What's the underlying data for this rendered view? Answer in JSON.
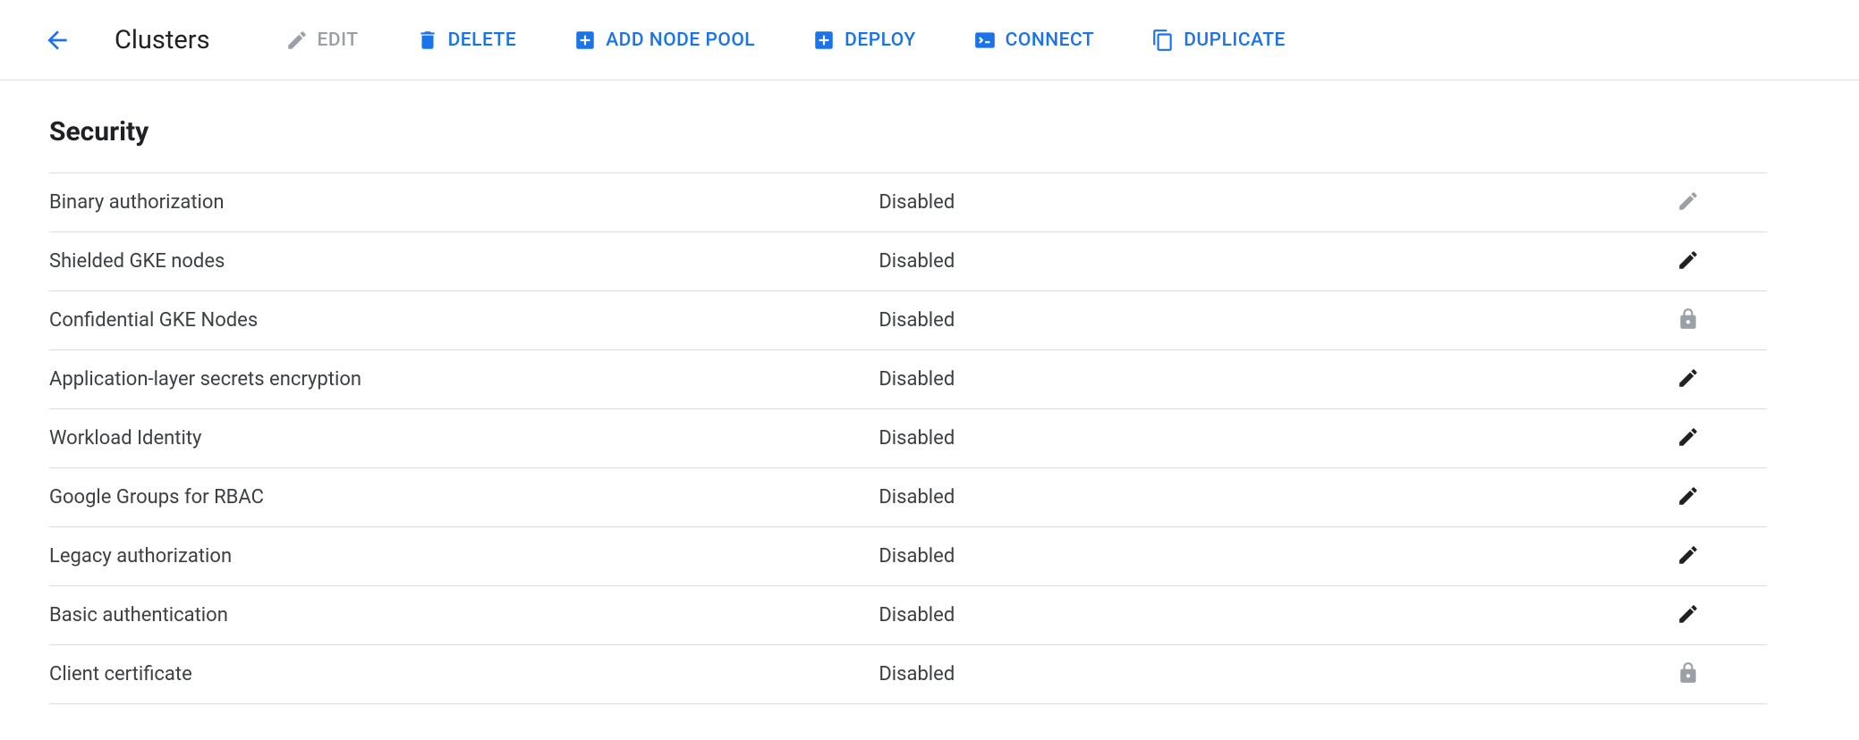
{
  "header": {
    "title": "Clusters",
    "actions": {
      "edit": "EDIT",
      "delete": "DELETE",
      "add_node_pool": "ADD NODE POOL",
      "deploy": "DEPLOY",
      "connect": "CONNECT",
      "duplicate": "DUPLICATE"
    }
  },
  "section": {
    "title": "Security",
    "rows": [
      {
        "label": "Binary authorization",
        "value": "Disabled",
        "action": "edit-dim"
      },
      {
        "label": "Shielded GKE nodes",
        "value": "Disabled",
        "action": "edit"
      },
      {
        "label": "Confidential GKE Nodes",
        "value": "Disabled",
        "action": "lock"
      },
      {
        "label": "Application-layer secrets encryption",
        "value": "Disabled",
        "action": "edit"
      },
      {
        "label": "Workload Identity",
        "value": "Disabled",
        "action": "edit"
      },
      {
        "label": "Google Groups for RBAC",
        "value": "Disabled",
        "action": "edit"
      },
      {
        "label": "Legacy authorization",
        "value": "Disabled",
        "action": "edit"
      },
      {
        "label": "Basic authentication",
        "value": "Disabled",
        "action": "edit"
      },
      {
        "label": "Client certificate",
        "value": "Disabled",
        "action": "lock"
      }
    ]
  }
}
